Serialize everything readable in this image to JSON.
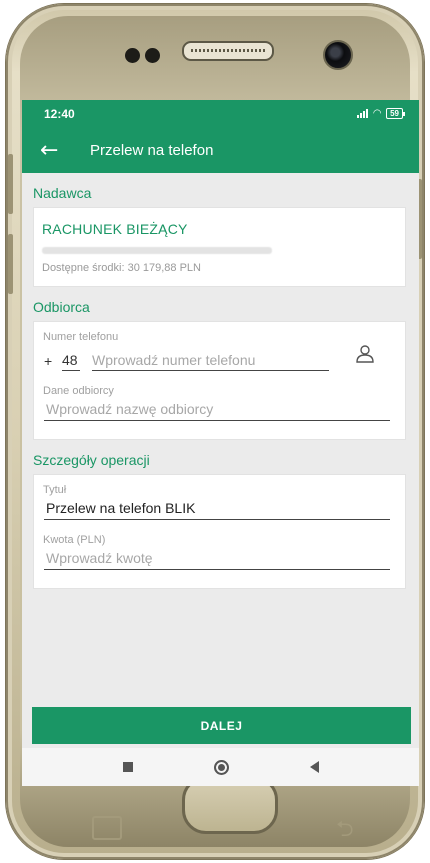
{
  "status": {
    "time": "12:40",
    "battery": "59"
  },
  "toolbar": {
    "title": "Przelew na telefon"
  },
  "sender": {
    "section_title": "Nadawca",
    "account_name": "RACHUNEK BIEŻĄCY",
    "available_funds": "Dostępne środki: 30 179,88 PLN"
  },
  "recipient": {
    "section_title": "Odbiorca",
    "phone_label": "Numer telefonu",
    "plus": "+",
    "country_prefix": "48",
    "phone_placeholder": "Wprowadź numer telefonu",
    "name_label": "Dane odbiorcy",
    "name_placeholder": "Wprowadź nazwę odbiorcy"
  },
  "details": {
    "section_title": "Szczegóły operacji",
    "title_label": "Tytuł",
    "title_value": "Przelew na telefon BLIK",
    "amount_label": "Kwota (PLN)",
    "amount_placeholder": "Wprowadź kwotę"
  },
  "action": {
    "next_label": "DALEJ"
  },
  "colors": {
    "accent": "#1a9665"
  }
}
